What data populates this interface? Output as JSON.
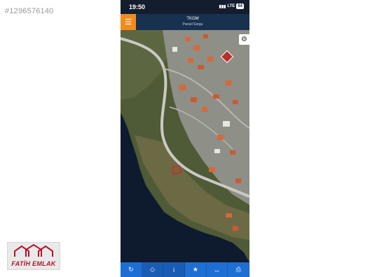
{
  "listing_id": "#1296576140",
  "status_bar": {
    "time": "19:50",
    "network": "LTE",
    "battery": "64"
  },
  "app": {
    "title": "TKGM",
    "subtitle": "Parsel Sorgu",
    "menu_icon": "hamburger-menu-icon",
    "settings_icon": "gear-icon"
  },
  "colors": {
    "header_bg": "#17314f",
    "menu_button": "#f08c1e",
    "toolbar_bg": "#1d6fd4",
    "parcel_outline": "#e02020",
    "brand_red": "#b8102a"
  },
  "toolbar": [
    {
      "icon": "refresh-icon",
      "glyph": "↻"
    },
    {
      "icon": "locate-icon",
      "glyph": "◇"
    },
    {
      "icon": "info-icon",
      "glyph": "i"
    },
    {
      "icon": "star-icon",
      "glyph": "★"
    },
    {
      "icon": "measure-icon",
      "glyph": "↔"
    },
    {
      "icon": "print-icon",
      "glyph": "⎙"
    }
  ],
  "logo": {
    "text": "FATİH EMLAK"
  }
}
